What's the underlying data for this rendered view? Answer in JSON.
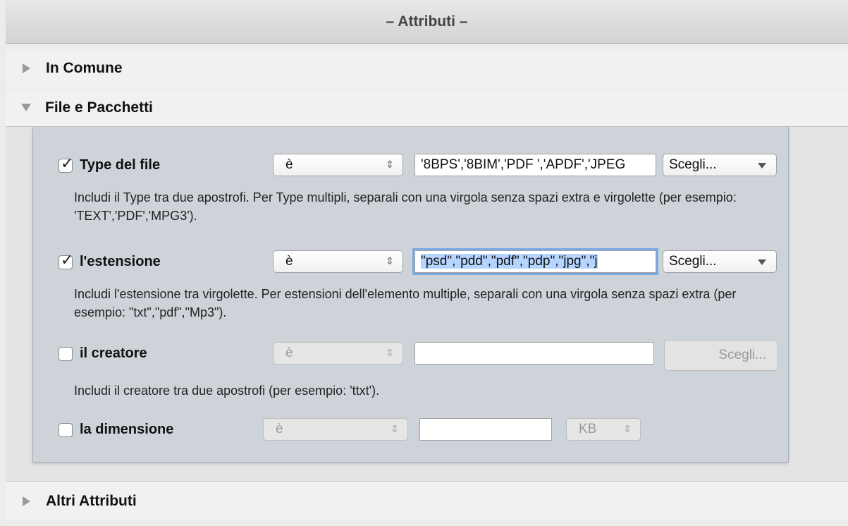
{
  "header": {
    "title": "– Attributi –"
  },
  "sections": {
    "common": {
      "label": "In Comune",
      "expanded": false
    },
    "files": {
      "label": "File e Pacchetti",
      "expanded": true
    },
    "other": {
      "label": "Altri Attributi",
      "expanded": false
    }
  },
  "criteria": {
    "type": {
      "label": "Type del file",
      "checked": true,
      "operator": "è",
      "value": "'8BPS','8BIM','PDF ','APDF','JPEG",
      "choose_label": "Scegli...",
      "help": "Includi il Type tra due apostrofi. Per Type multipli, separali con una virgola senza spazi extra e virgolette (per esempio: 'TEXT','PDF','MPG3')."
    },
    "extension": {
      "label": "l'estensione",
      "checked": true,
      "operator": "è",
      "value": "\"psd\",\"pdd\",\"pdf\",\"pdp\",\"jpg\",\"j",
      "choose_label": "Scegli...",
      "help": "Includi l'estensione tra virgolette. Per estensioni dell'elemento multiple, separali con una virgola senza spazi extra (per esempio: \"txt\",\"pdf\",\"Mp3\")."
    },
    "creator": {
      "label": "il creatore",
      "checked": false,
      "operator": "è",
      "value": "",
      "choose_label": "Scegli...",
      "help": "Includi il creatore tra due apostrofi (per esempio: 'ttxt')."
    },
    "size": {
      "label": "la dimensione",
      "checked": false,
      "operator": "è",
      "value": "",
      "unit": "KB"
    }
  },
  "icons": {
    "collapsed": "disclosure-triangle-right-icon",
    "expanded": "disclosure-triangle-down-icon",
    "stepper": "up-down-arrows-icon",
    "popup": "chevron-down-icon"
  },
  "colors": {
    "panel_bg": "#cdd3d8",
    "selection": "#b5d5ff",
    "focus_ring": "#7aa9e6"
  }
}
